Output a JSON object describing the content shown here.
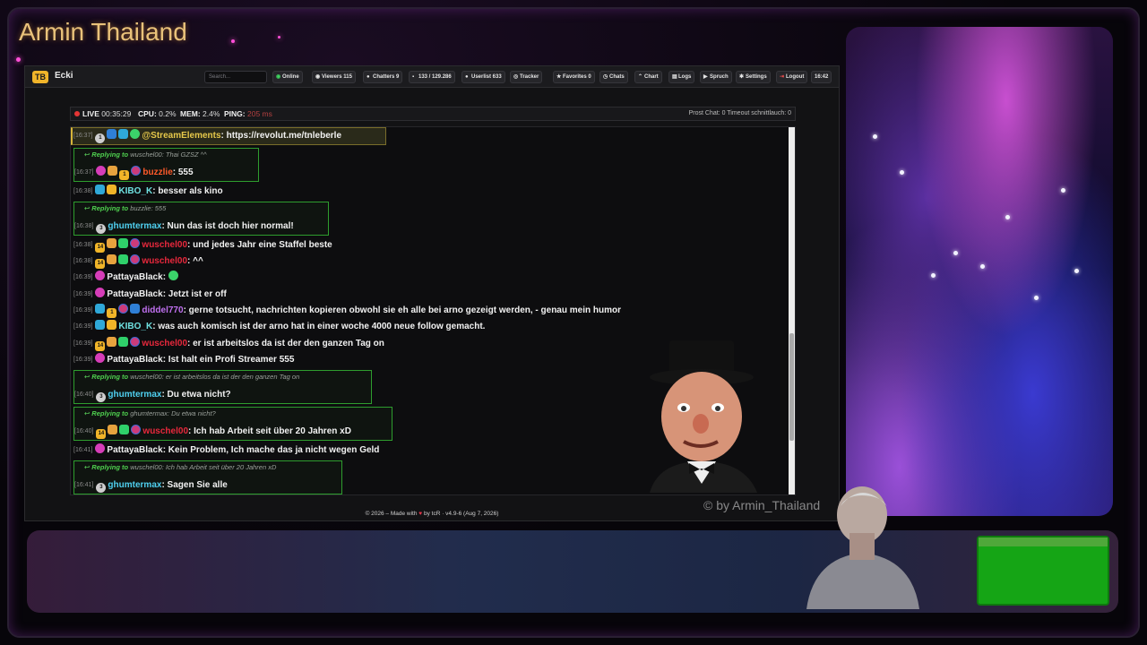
{
  "overlay": {
    "stream_title": "Armin Thailand",
    "watermark": "© by Armin_Thailand",
    "colors": {
      "title": "#e9c27a",
      "greenscreen": "#15a515",
      "accent_pink": "#ff4fd8"
    }
  },
  "topbar": {
    "logo_text": "TB",
    "channel": "Ecki",
    "search_placeholder": "Search...",
    "buttons": [
      {
        "label": "Online",
        "icon": "signal-icon"
      },
      {
        "label": "Viewers 115",
        "icon": "eye-icon"
      },
      {
        "label": "Chatters 9",
        "icon": "users-icon"
      },
      {
        "label": "133 / 129.286",
        "icon": "chat-icon"
      },
      {
        "label": "Userlist 633",
        "icon": "user-icon"
      },
      {
        "label": "Tracker",
        "icon": "tracker-icon"
      },
      {
        "label": "Favorites 0",
        "icon": "star-icon"
      },
      {
        "label": "Chats",
        "icon": "history-icon"
      },
      {
        "label": "Chart",
        "icon": "chart-icon"
      },
      {
        "label": "Logs",
        "icon": "logs-icon"
      },
      {
        "label": "Spruch",
        "icon": "quote-icon"
      },
      {
        "label": "Settings",
        "icon": "gear-icon"
      },
      {
        "label": "Logout",
        "icon": "logout-icon"
      },
      {
        "label": "16:42",
        "icon": ""
      }
    ]
  },
  "status": {
    "live_label": "LIVE",
    "uptime": "00:35:29",
    "cpu_label": "CPU:",
    "cpu_value": "0.2%",
    "mem_label": "MEM:",
    "mem_value": "2.4%",
    "ping_label": "PING:",
    "ping_value": "205 ms",
    "right_text": "Prost Chat: 0  Timeout schnittlauch: 0"
  },
  "chat": {
    "messages": [
      {
        "ts": "[16:37]",
        "user": "@StreamElements",
        "color": "#e6c84a",
        "text": "https://revolut.me/tnleberle",
        "highlight": true
      },
      {
        "reply_to": "wuschel00",
        "reply_text": "Thai GZSZ ^^",
        "ts": "[16:37]",
        "user": "buzzlie",
        "color": "#ff5a2a",
        "text": "555"
      },
      {
        "ts": "[16:38]",
        "user": "KIBO_K",
        "color": "#6fe0e0",
        "text": "besser als kino"
      },
      {
        "reply_to": "buzzlie",
        "reply_text": "555",
        "ts": "[16:38]",
        "user": "ghumtermax",
        "color": "#4fd0f0",
        "text": "Nun das ist doch hier normal!"
      },
      {
        "ts": "[16:38]",
        "user": "wuschel00",
        "color": "#e8283c",
        "text": "und jedes Jahr eine Staffel beste"
      },
      {
        "ts": "[16:38]",
        "user": "wuschel00",
        "color": "#e8283c",
        "text": "^^"
      },
      {
        "ts": "[16:39]",
        "user": "PattayaBlack",
        "color": "#f0f0f0",
        "text": ""
      },
      {
        "ts": "[16:39]",
        "user": "PattayaBlack",
        "color": "#f0f0f0",
        "text": "Jetzt ist er off"
      },
      {
        "ts": "[16:39]",
        "user": "diddel770",
        "color": "#c070f0",
        "text": "gerne totsucht, nachrichten kopieren obwohl sie eh alle bei arno gezeigt werden, - genau mein humor"
      },
      {
        "ts": "[16:39]",
        "user": "KIBO_K",
        "color": "#6fe0e0",
        "text": "was auch komisch ist der arno hat in einer woche 4000 neue follow gemacht."
      },
      {
        "ts": "[16:39]",
        "user": "wuschel00",
        "color": "#e8283c",
        "text": "er ist arbeitslos da ist der den ganzen Tag on"
      },
      {
        "ts": "[16:39]",
        "user": "PattayaBlack",
        "color": "#f0f0f0",
        "text": "Ist halt ein Profi Streamer 555"
      },
      {
        "reply_to": "wuschel00",
        "reply_text": "er ist arbeitslos da ist der den ganzen Tag on",
        "ts": "[16:40]",
        "user": "ghumtermax",
        "color": "#4fd0f0",
        "text": "Du etwa nicht?"
      },
      {
        "reply_to": "ghumtermax",
        "reply_text": "Du etwa nicht?",
        "ts": "[16:40]",
        "user": "wuschel00",
        "color": "#e8283c",
        "text": "Ich hab Arbeit seit über 20 Jahren xD"
      },
      {
        "ts": "[16:41]",
        "user": "PattayaBlack",
        "color": "#f0f0f0",
        "text": "Kein Problem, Ich mache das ja nicht wegen Geld"
      },
      {
        "reply_to": "wuschel00",
        "reply_text": "Ich hab Arbeit seit über 20 Jahren xD",
        "ts": "[16:41]",
        "user": "ghumtermax",
        "color": "#4fd0f0",
        "text": "Sagen Sie alle"
      }
    ],
    "replying_prefix": "Replying to"
  },
  "footer": {
    "text_before": "© 2026 – Made with",
    "text_after": "by tcR · v4.9-6 (Aug 7, 2026)"
  }
}
